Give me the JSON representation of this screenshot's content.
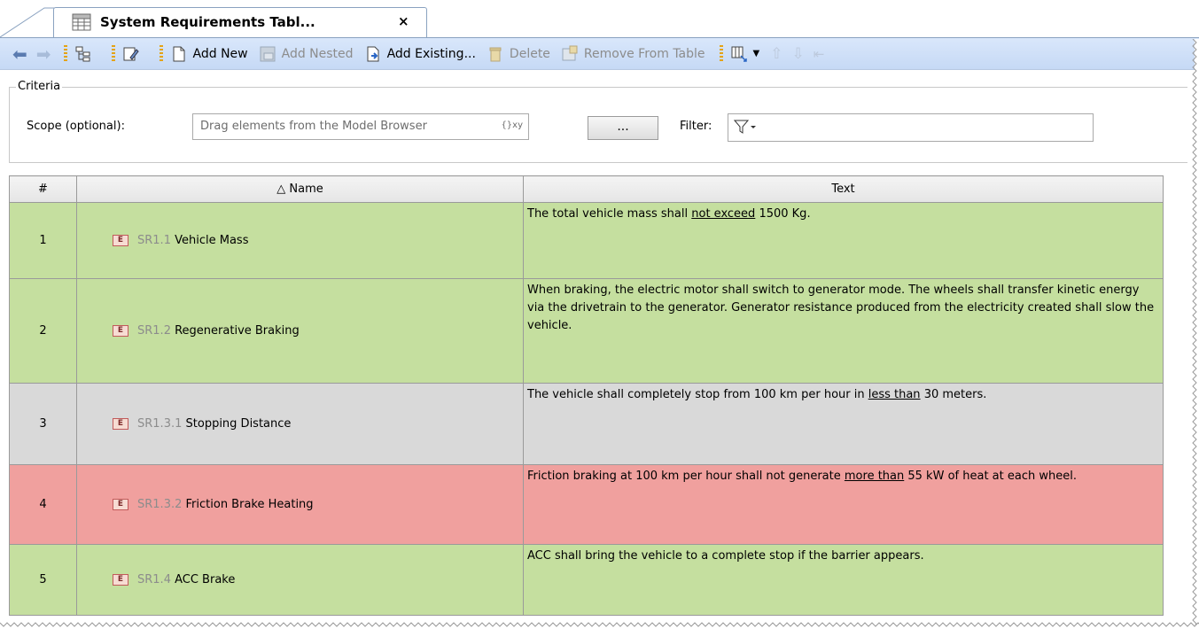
{
  "tab": {
    "title": "System Requirements Tabl...",
    "close": "×"
  },
  "toolbar": {
    "add_new": "Add New",
    "add_nested": "Add Nested",
    "add_existing": "Add Existing...",
    "delete": "Delete",
    "remove_from_table": "Remove From Table"
  },
  "criteria": {
    "legend": "Criteria",
    "scope_label": "Scope (optional):",
    "scope_placeholder": "Drag elements from the Model Browser",
    "scope_suffix": "{}xy",
    "ellipsis": "...",
    "filter_label": "Filter:"
  },
  "table": {
    "columns": [
      "#",
      "△ Name",
      "Text"
    ],
    "rows": [
      {
        "num": "1",
        "id": "SR1.1",
        "name": "Vehicle Mass",
        "status": "green",
        "text_a": "The total vehicle mass shall ",
        "text_u": "not exceed",
        "text_b": " 1500 Kg."
      },
      {
        "num": "2",
        "id": "SR1.2",
        "name": "Regenerative Braking",
        "status": "green",
        "text_a": "When braking, the electric motor shall switch to generator mode. The wheels shall transfer kinetic energy via the drivetrain to the generator. Generator resistance produced from the electricity created shall slow the vehicle.",
        "text_u": "",
        "text_b": ""
      },
      {
        "num": "3",
        "id": "SR1.3.1",
        "name": "Stopping Distance",
        "status": "gray",
        "text_a": "The vehicle shall completely stop from 100 km per hour in ",
        "text_u": "less than",
        "text_b": " 30 meters."
      },
      {
        "num": "4",
        "id": "SR1.3.2",
        "name": "Friction Brake Heating",
        "status": "red",
        "text_a": "Friction braking at 100 km per hour shall not generate ",
        "text_u": "more than",
        "text_b": " 55 kW of heat at each wheel."
      },
      {
        "num": "5",
        "id": "SR1.4",
        "name": "ACC Brake",
        "status": "green",
        "text_a": "ACC shall bring the vehicle to a complete stop if the barrier appears.",
        "text_u": "",
        "text_b": ""
      }
    ]
  },
  "colors": {
    "green": "#c5df9f",
    "gray": "#d9d9d9",
    "red": "#f0a09e"
  },
  "icons": {
    "element": "E"
  }
}
